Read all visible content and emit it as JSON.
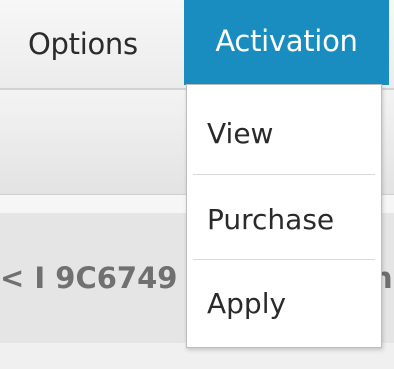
{
  "menubar": {
    "items": [
      {
        "label": "Options"
      },
      {
        "label": "Activation"
      }
    ]
  },
  "activation_menu": {
    "items": [
      {
        "label": "View"
      },
      {
        "label": "Purchase"
      },
      {
        "label": "Apply"
      }
    ]
  },
  "content": {
    "visible_text": "< I 9C6749",
    "trailing_text": "n"
  },
  "colors": {
    "accent": "#1a8dc0",
    "menubar_bg": "#f2f2f2",
    "dropdown_bg": "#ffffff",
    "muted_text": "#707070"
  }
}
